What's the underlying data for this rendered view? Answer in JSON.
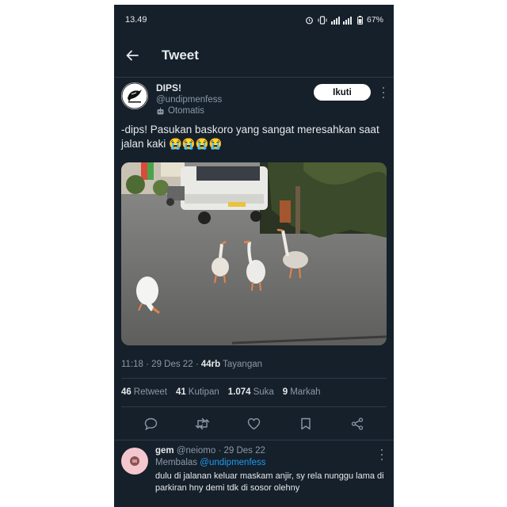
{
  "status_bar": {
    "time": "13.49",
    "battery": "67%"
  },
  "header": {
    "title": "Tweet"
  },
  "tweet": {
    "name": "DIPS!",
    "handle": "@undipmenfess",
    "automated": "Otomatis",
    "follow_label": "Ikuti",
    "text": "-dips! Pasukan baskoro yang sangat meresahkan saat jalan kaki 😭😭😭😭",
    "time": "11:18",
    "date": "29 Des 22",
    "views_count": "44rb",
    "views_label": "Tayangan",
    "stats": [
      {
        "count": "46",
        "label": "Retweet"
      },
      {
        "count": "41",
        "label": "Kutipan"
      },
      {
        "count": "1.074",
        "label": "Suka"
      },
      {
        "count": "9",
        "label": "Markah"
      }
    ]
  },
  "actions": [
    "reply-icon",
    "retweet-icon",
    "like-icon",
    "bookmark-icon",
    "share-icon"
  ],
  "reply": {
    "name": "gem",
    "handle": "@neiomo",
    "date": "29 Des 22",
    "replying_prefix": "Membalas",
    "replying_to": "@undipmenfess",
    "text": "dulu di jalanan keluar maskam anjir, sy rela nunggu lama di parkiran hny demi tdk di sosor olehny"
  },
  "colors": {
    "background": "#15202b",
    "text": "#e7e9ea",
    "secondary": "#8b98a5",
    "accent": "#1d9bf0"
  }
}
